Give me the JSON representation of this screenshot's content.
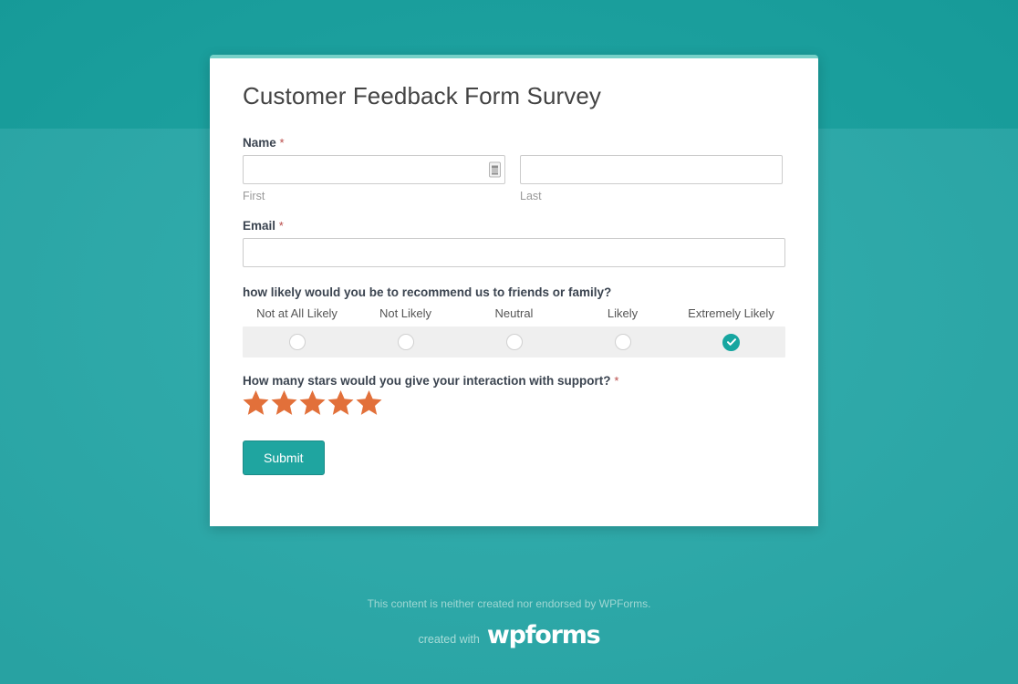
{
  "background": {
    "top_band_color": "#17a2a0",
    "bottom_band_color": "#2aabab"
  },
  "card": {
    "accent_color": "#77d1c8",
    "title": "Customer Feedback Form Survey"
  },
  "fields": {
    "name": {
      "label": "Name",
      "required_marker": "*",
      "first": {
        "value": "",
        "placeholder": "",
        "sub_label": "First",
        "autofill_icon": "contact-card-icon"
      },
      "last": {
        "value": "",
        "placeholder": "",
        "sub_label": "Last"
      }
    },
    "email": {
      "label": "Email",
      "required_marker": "*",
      "value": "",
      "placeholder": ""
    },
    "likert": {
      "question": "how likely would you be to recommend us to friends or family?",
      "options": [
        {
          "label": "Not at All Likely",
          "selected": false
        },
        {
          "label": "Not Likely",
          "selected": false
        },
        {
          "label": "Neutral",
          "selected": false
        },
        {
          "label": "Likely",
          "selected": false
        },
        {
          "label": "Extremely Likely",
          "selected": true
        }
      ],
      "selected_color": "#16a6a0",
      "row_background": "#efefef"
    },
    "stars": {
      "question": "How many stars would you give your interaction with support?",
      "required_marker": "*",
      "total": 5,
      "filled": 5,
      "star_color": "#e2703a"
    }
  },
  "submit": {
    "label": "Submit",
    "background_color": "#1fa5a0",
    "text_color": "#ffffff"
  },
  "footer": {
    "disclaimer": "This content is neither created nor endorsed by WPForms.",
    "created_with_label": "created with",
    "brand": "wpforms"
  }
}
